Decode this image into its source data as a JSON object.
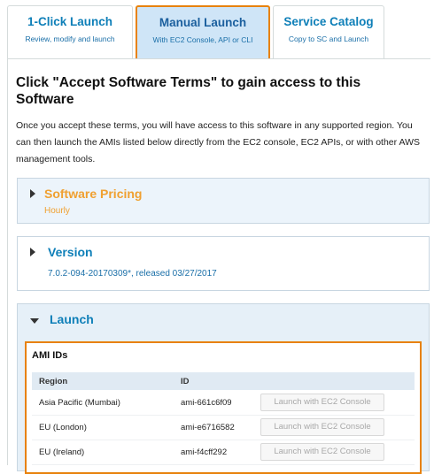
{
  "tabs": [
    {
      "title": "1-Click Launch",
      "subtitle": "Review, modify and launch"
    },
    {
      "title": "Manual Launch",
      "subtitle": "With EC2 Console, API or CLI"
    },
    {
      "title": "Service Catalog",
      "subtitle": "Copy to SC and Launch"
    }
  ],
  "active_tab": "Manual Launch",
  "main": {
    "heading": "Click \"Accept Software Terms\" to gain access to this Software",
    "description": "Once you accept these terms, you will have access to this software in any supported region. You can then launch the AMIs listed below directly from the EC2 console, EC2 APIs, or with other AWS management tools."
  },
  "pricing": {
    "title": "Software Pricing",
    "value": "Hourly"
  },
  "version": {
    "title": "Version",
    "value": "7.0.2-094-20170309*, released 03/27/2017"
  },
  "launch": {
    "title": "Launch",
    "ami_title": "AMI IDs",
    "col_region": "Region",
    "col_id": "ID",
    "rows": [
      {
        "region": "Asia Pacific (Mumbai)",
        "id": "ami-661c6f09",
        "button": "Launch with EC2 Console"
      },
      {
        "region": "EU (London)",
        "id": "ami-e6716582",
        "button": "Launch with EC2 Console"
      },
      {
        "region": "EU (Ireland)",
        "id": "ami-f4cff292",
        "button": "Launch with EC2 Console"
      }
    ]
  },
  "colors": {
    "accent_orange": "#e8820c",
    "link_blue": "#0e7fb8",
    "pricing_orange": "#f0a030",
    "active_tab_bg": "#cfe5f7"
  }
}
